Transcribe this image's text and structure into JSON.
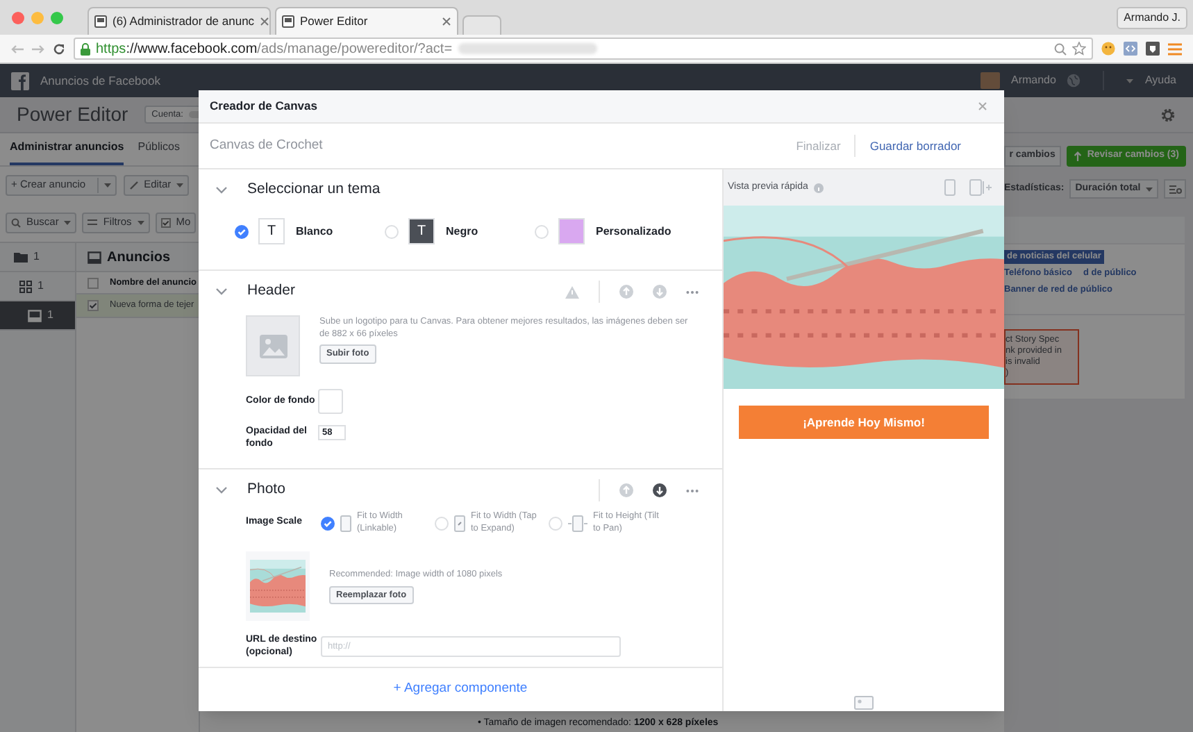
{
  "browser": {
    "tabs": [
      {
        "title": "(6) Administrador de anunc",
        "selected": false
      },
      {
        "title": "Power Editor",
        "selected": true
      }
    ],
    "profile": "Armando J.",
    "url": {
      "scheme": "https",
      "host": "://www.facebook.com",
      "path": "/ads/manage/powereditor/?act="
    }
  },
  "fb_bar": {
    "title": "Anuncios de Facebook",
    "user": "Armando",
    "help": "Ayuda"
  },
  "editor": {
    "title": "Power Editor",
    "account_label": "Cuenta:",
    "tabs": [
      {
        "label": "Administrar anuncios",
        "selected": true
      },
      {
        "label": "Públicos",
        "selected": false
      }
    ],
    "create_button": "+ Crear anuncio",
    "edit_button": "Editar",
    "search_button": "Buscar",
    "filters_button": "Filtros",
    "third_button": "Mo",
    "tree": [
      {
        "kind": "campaign",
        "count": "1",
        "selected": false
      },
      {
        "kind": "adset",
        "count": "1",
        "selected": false
      },
      {
        "kind": "ad",
        "count": "1",
        "selected": true
      }
    ],
    "ads_title": "Anuncios",
    "column": "Nombre del anuncio",
    "header_checked": false,
    "row": {
      "name": "Nueva forma de tejer",
      "checked": true
    },
    "discard_button": "r cambios",
    "review_button": "Revisar cambios (3)",
    "stats_label": "Estadísticas:",
    "stats_value": "Duración total",
    "placements": [
      {
        "label": "de noticias del celular",
        "selected": true
      },
      {
        "label": "Teléfono básico",
        "selected": false
      },
      {
        "label": "d de público",
        "selected": false
      },
      {
        "label": "Banner de red de público",
        "selected": false
      }
    ],
    "error_lines": [
      "ct Story Spec",
      "nk provided in",
      "is invalid",
      ")"
    ],
    "spec_line": "• Tamaño de imagen recomendado: **1200 x 628 píxeles**"
  },
  "modal": {
    "title": "Creador de Canvas",
    "canvas_name": "Canvas de Crochet",
    "actions": [
      {
        "label": "Finalizar",
        "disabled": true
      },
      {
        "label": "Guardar borrador",
        "disabled": false
      }
    ],
    "theme_section": {
      "title": "Seleccionar un tema",
      "themes": [
        {
          "label": "Blanco",
          "selected": true,
          "color": "#ffffff",
          "tile_text": "T"
        },
        {
          "label": "Negro",
          "selected": false,
          "color": "#4b4f56",
          "tile_text": "T"
        },
        {
          "label": "Personalizado",
          "selected": false,
          "color": "#d9a8f0"
        }
      ]
    },
    "header_section": {
      "title": "Header",
      "up_disabled": true,
      "down_disabled": true,
      "hint": "Sube un logotipo para tu Canvas. Para obtener mejores resultados, las imágenes deben ser de 882 x 66 píxeles",
      "upload_button": "Subir foto",
      "bg_color_label": "Color de fondo",
      "opacity_label": "Opacidad del fondo",
      "opacity_value": "58"
    },
    "photo_section": {
      "title": "Photo",
      "up_disabled": true,
      "down_disabled": false,
      "scale_label": "Image Scale",
      "scale_options": [
        {
          "label": "Fit to Width (Linkable)",
          "selected": true,
          "kind": "width"
        },
        {
          "label": "Fit to Width (Tap to Expand)",
          "selected": false,
          "kind": "expand"
        },
        {
          "label": "Fit to Height (Tilt to Pan)",
          "selected": false,
          "kind": "height"
        }
      ],
      "recommendation": "Recommended: Image width of 1080 pixels",
      "replace_button": "Reemplazar foto",
      "url_label": "URL de destino (opcional)",
      "url_placeholder": "http://"
    },
    "add_component": "+ Agregar componente",
    "preview": {
      "title": "Vista previa rápida",
      "button": "¡Aprende Hoy Mismo!"
    }
  }
}
